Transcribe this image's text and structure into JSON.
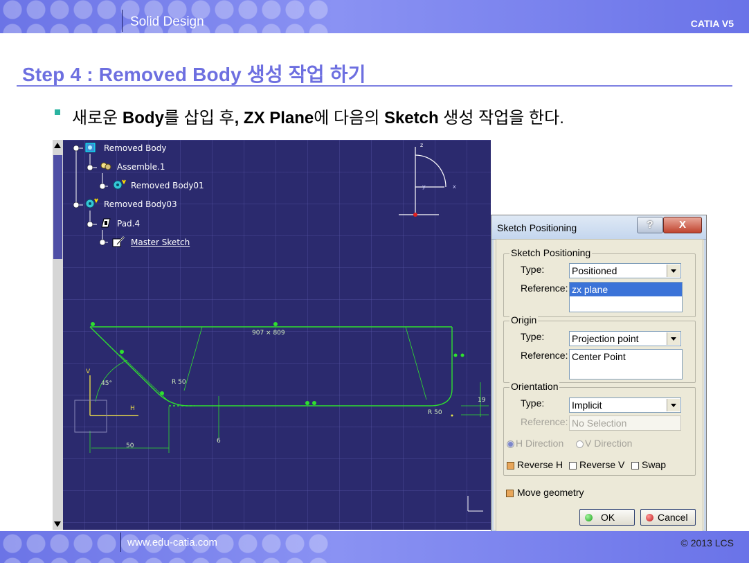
{
  "header": {
    "title": "Solid Design",
    "brand": "CATIA V5"
  },
  "footer": {
    "url": "www.edu-catia.com",
    "copyright": "© 2013 LCS"
  },
  "slide": {
    "heading": "Step 4 : Removed Body 생성 작업 하기",
    "bullet": {
      "p1": "새로운 ",
      "b1": "Body",
      "p2": "를 삽입 후",
      "b2": ", ZX Plane",
      "p3": "에 다음의 ",
      "b3": "Sketch",
      "p4": " 생성 작업을 한다."
    }
  },
  "tree": {
    "items": [
      {
        "label": "Removed Body"
      },
      {
        "label": "Assemble.1"
      },
      {
        "label": "Removed Body01"
      },
      {
        "label": "Removed Body03"
      },
      {
        "label": "Pad.4"
      },
      {
        "label": "Master Sketch"
      }
    ]
  },
  "sketch": {
    "coord_label": "907 × 809",
    "dim_r50_a": "R 50",
    "dim_r50_b": "R 50",
    "dim_45": "45°",
    "dim_50": "50",
    "dim_6": "6",
    "dim_19": "19",
    "axis_h": "H",
    "axis_v": "V",
    "compass_z": "z",
    "compass_x": "x",
    "compass_y": "y"
  },
  "dialog": {
    "title": "Sketch Positioning",
    "help": "?",
    "close": "X",
    "sketch_positioning": {
      "title": "Sketch Positioning",
      "type_label": "Type:",
      "type_value": "Positioned",
      "reference_label": "Reference:",
      "reference_value": "zx plane"
    },
    "origin": {
      "title": "Origin",
      "type_label": "Type:",
      "type_value": "Projection point",
      "reference_label": "Reference:",
      "reference_value": "Center Point"
    },
    "orientation": {
      "title": "Orientation",
      "type_label": "Type:",
      "type_value": "Implicit",
      "reference_label": "Reference:",
      "reference_value": "No Selection",
      "h_direction": "H Direction",
      "v_direction": "V Direction",
      "reverse_h": "Reverse H",
      "reverse_v": "Reverse V",
      "swap": "Swap"
    },
    "move_geometry": "Move geometry",
    "ok": "OK",
    "cancel": "Cancel"
  },
  "colors": {
    "accent": "#6d6fe0",
    "viewport_bg": "#2b2a6e",
    "sketch_line": "#2fe02f"
  }
}
